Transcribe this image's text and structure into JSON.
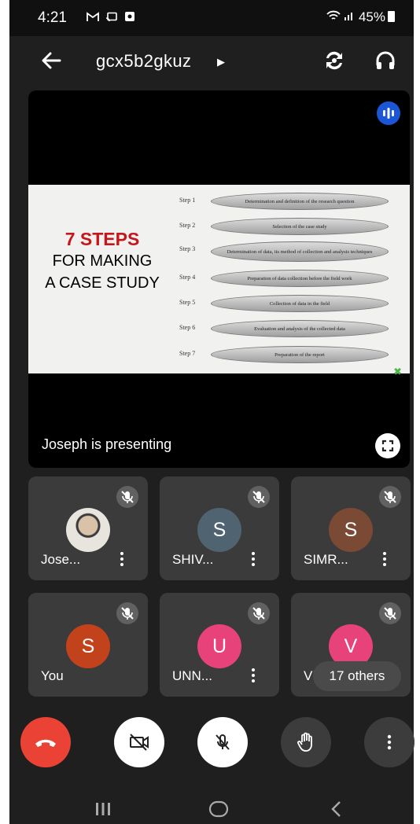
{
  "status_bar": {
    "time": "4:21",
    "left_icons": [
      "gmail-icon",
      "cast-icon",
      "screenshot-icon"
    ],
    "battery": "45%"
  },
  "header": {
    "meeting_code": "gcx5b2gkuz"
  },
  "presentation": {
    "slide": {
      "title_line1": "7 STEPS",
      "title_line2": "FOR MAKING",
      "title_line3": "A CASE STUDY",
      "steps": [
        {
          "label": "Step 1",
          "text": "Determination and definition of the research question"
        },
        {
          "label": "Step 2",
          "text": "Selection of the case study"
        },
        {
          "label": "Step 3",
          "text": "Determination of data, its method of collection and analysis techniques"
        },
        {
          "label": "Step 4",
          "text": "Preparation of data collection before the field work"
        },
        {
          "label": "Step 5",
          "text": "Collection of data in the field"
        },
        {
          "label": "Step 6",
          "text": "Evaluation and analysis of the collected data"
        },
        {
          "label": "Step 7",
          "text": "Preparation of the report"
        }
      ]
    },
    "presenter_text": "Joseph is presenting"
  },
  "participants": [
    {
      "name": "Jose...",
      "avatar_type": "photo"
    },
    {
      "name": "SHIV...",
      "initial": "S",
      "color": "#4f6470"
    },
    {
      "name": "SIMR...",
      "initial": "S",
      "color": "#7a4a35"
    },
    {
      "name": "You",
      "initial": "S",
      "color": "#c2421b"
    },
    {
      "name": "UNN...",
      "initial": "U",
      "color": "#e8427a"
    },
    {
      "name": "VI",
      "initial": "V",
      "color": "#e8427a"
    }
  ],
  "others_badge": "17 others",
  "controls": [
    "end-call-icon",
    "camera-off-icon",
    "mic-off-icon",
    "raise-hand-icon",
    "more-options-icon"
  ],
  "colors": {
    "end_call": "#ea4335",
    "accent_blue": "#1a56d6"
  }
}
